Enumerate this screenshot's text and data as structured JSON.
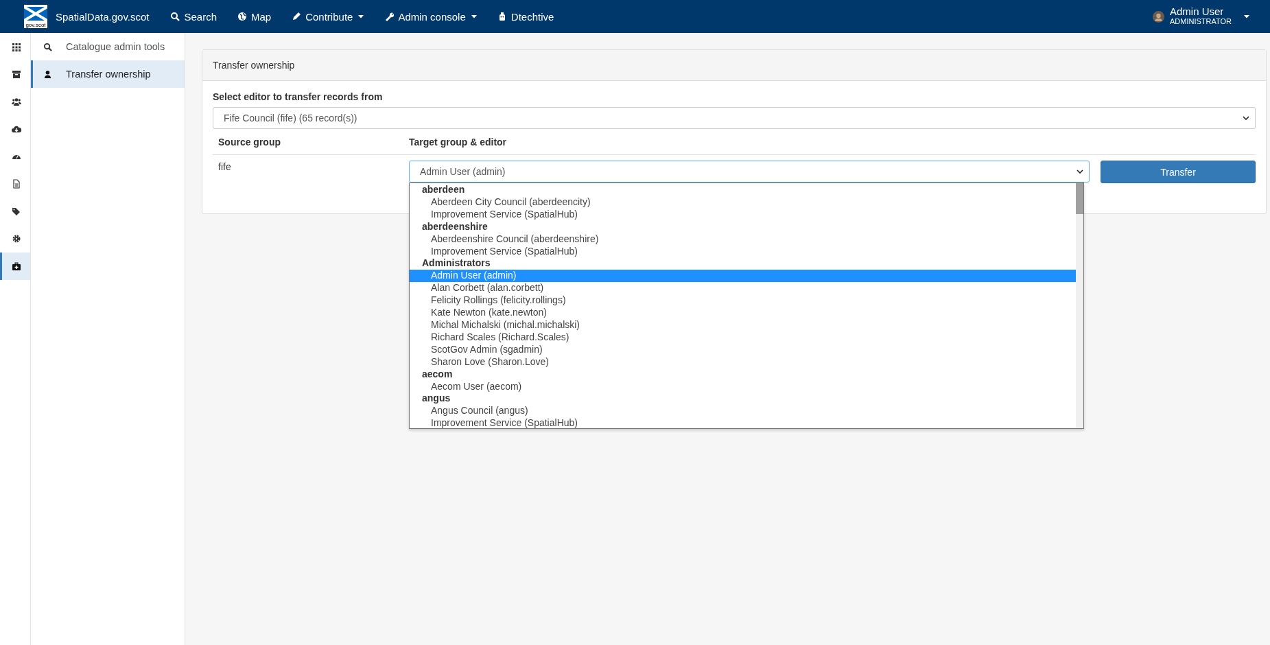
{
  "navbar": {
    "brand": "SpatialData.gov.scot",
    "logo_caption": "gov.scot",
    "items": [
      {
        "label": "Search",
        "kind": "search",
        "dropdown": false
      },
      {
        "label": "Map",
        "kind": "globe",
        "dropdown": false
      },
      {
        "label": "Contribute",
        "kind": "pencil",
        "dropdown": true
      },
      {
        "label": "Admin console",
        "kind": "wrench",
        "dropdown": true
      },
      {
        "label": "Dtechtive",
        "kind": "robot",
        "dropdown": false
      }
    ],
    "user": {
      "name": "Admin User",
      "role": "ADMINISTRATOR"
    }
  },
  "icon_rail": [
    {
      "kind": "apps",
      "selected": false
    },
    {
      "kind": "archive",
      "selected": false
    },
    {
      "kind": "users",
      "selected": false
    },
    {
      "kind": "cloud",
      "selected": false
    },
    {
      "kind": "dashboard",
      "selected": false
    },
    {
      "kind": "file",
      "selected": false
    },
    {
      "kind": "tags",
      "selected": false
    },
    {
      "kind": "gear",
      "selected": false
    },
    {
      "kind": "toolbox",
      "selected": true
    }
  ],
  "sidebar": {
    "items": [
      {
        "label": "Catalogue admin tools",
        "kind": "search",
        "selected": false
      },
      {
        "label": "Transfer ownership",
        "kind": "user",
        "selected": true
      }
    ]
  },
  "panel": {
    "title": "Transfer ownership",
    "source_label": "Select editor to transfer records from",
    "source_value": "Fife Council (fife) (65 record(s))",
    "columns": [
      "Source group",
      "Target group & editor"
    ],
    "row": {
      "source_group": "fife",
      "target_value": "Admin User (admin)",
      "button": "Transfer"
    }
  },
  "dropdown_list": [
    {
      "group": "aberdeen",
      "options": [
        {
          "label": "Aberdeen City Council (aberdeencity)",
          "selected": false
        },
        {
          "label": "Improvement Service (SpatialHub)",
          "selected": false
        }
      ]
    },
    {
      "group": "aberdeenshire",
      "options": [
        {
          "label": "Aberdeenshire Council (aberdeenshire)",
          "selected": false
        },
        {
          "label": "Improvement Service (SpatialHub)",
          "selected": false
        }
      ]
    },
    {
      "group": "Administrators",
      "options": [
        {
          "label": "Admin User (admin)",
          "selected": true
        },
        {
          "label": "Alan Corbett (alan.corbett)",
          "selected": false
        },
        {
          "label": "Felicity Rollings (felicity.rollings)",
          "selected": false
        },
        {
          "label": "Kate Newton (kate.newton)",
          "selected": false
        },
        {
          "label": "Michal Michalski (michal.michalski)",
          "selected": false
        },
        {
          "label": "Richard Scales (Richard.Scales)",
          "selected": false
        },
        {
          "label": "ScotGov Admin (sgadmin)",
          "selected": false
        },
        {
          "label": "Sharon Love (Sharon.Love)",
          "selected": false
        }
      ]
    },
    {
      "group": "aecom",
      "options": [
        {
          "label": "Aecom User (aecom)",
          "selected": false
        }
      ]
    },
    {
      "group": "angus",
      "options": [
        {
          "label": "Angus Council (angus)",
          "selected": false
        },
        {
          "label": "Improvement Service (SpatialHub)",
          "selected": false
        }
      ]
    }
  ]
}
